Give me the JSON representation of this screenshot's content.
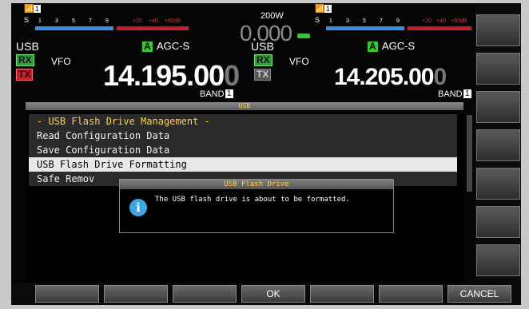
{
  "power": "200W",
  "center_freq": "0.000",
  "colors": {
    "accent_green": "#39c832",
    "rx_bg": "#2f9e3a",
    "tx_bg": "#c8202a",
    "meter_blue": "#3b8fe0",
    "menu_title": "#ffd24a",
    "selected_row": "#e8e8e8"
  },
  "left_rx": {
    "ant_num": "1",
    "s_label": "S",
    "meter_ticks": [
      "1",
      "3",
      "5",
      "7",
      "9"
    ],
    "meter_red_ticks": [
      "+20",
      "+40",
      "+60dB"
    ],
    "mode": "USB",
    "agc": "AGC-S",
    "agc_badge": "A",
    "vfo": "VFO",
    "rx": "RX",
    "tx": "TX",
    "freq_main": "14.195.00",
    "freq_last": "0",
    "band_label": "BAND",
    "band_num": "1"
  },
  "right_rx": {
    "ant_num": "1",
    "s_label": "S",
    "meter_ticks": [
      "1",
      "3",
      "5",
      "7",
      "9"
    ],
    "meter_red_ticks": [
      "+20",
      "+40",
      "+60dB"
    ],
    "mode": "USB",
    "agc": "AGC-S",
    "agc_badge": "A",
    "vfo": "VFO",
    "rx": "RX",
    "tx": "TX",
    "freq_main": "14.205.00",
    "freq_last": "0",
    "band_label": "BAND",
    "band_num": "1"
  },
  "usb_menu": {
    "title": "USB",
    "header": "- USB Flash Drive Management -",
    "items": [
      "Read Configuration Data",
      "Save Configuration Data",
      "USB Flash Drive Formatting",
      "Safe Remov"
    ],
    "selected_index": 2
  },
  "dialog": {
    "title": "USB Flash Drive",
    "icon": "info-icon",
    "message": "The USB flash drive is about to be formatted."
  },
  "softkeys": [
    "",
    "",
    "",
    "OK",
    "",
    "",
    "CANCEL"
  ]
}
